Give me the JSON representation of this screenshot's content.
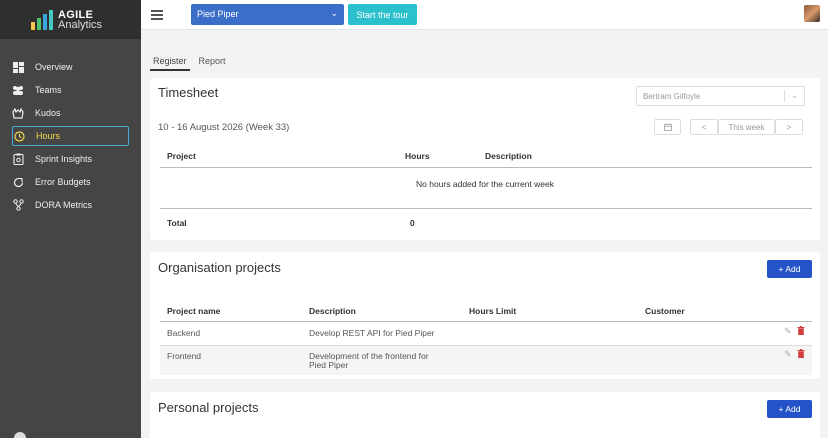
{
  "app": {
    "logo_line1": "AGILE",
    "logo_line2": "Analytics"
  },
  "sidebar": {
    "items": [
      {
        "label": "Overview",
        "icon": "dashboard-icon"
      },
      {
        "label": "Teams",
        "icon": "teams-icon"
      },
      {
        "label": "Kudos",
        "icon": "kudos-hands-icon"
      },
      {
        "label": "Hours",
        "icon": "clock-icon",
        "active": true
      },
      {
        "label": "Sprint Insights",
        "icon": "sprint-insights-icon"
      },
      {
        "label": "Error Budgets",
        "icon": "error-budget-icon"
      },
      {
        "label": "DORA Metrics",
        "icon": "dora-metrics-icon"
      }
    ]
  },
  "topbar": {
    "team_selected": "Pied Piper",
    "tour_button": "Start the tour"
  },
  "tabs": [
    "Register",
    "Report"
  ],
  "timesheet": {
    "title": "Timesheet",
    "user_selected": "Bertram Gilfoyle",
    "week_label": "10 - 16 August 2026 (Week 33)",
    "this_week_button": "This week",
    "prev_arrow": "<",
    "next_arrow": ">",
    "columns": [
      "Project",
      "Hours",
      "Description"
    ],
    "empty_message": "No hours added for the current week",
    "total_label": "Total",
    "total_value": "0"
  },
  "org_projects": {
    "title": "Organisation projects",
    "add_button": "+ Add",
    "columns": [
      "Project name",
      "Description",
      "Hours Limit",
      "Customer"
    ],
    "rows": [
      {
        "name": "Backend",
        "description": "Develop REST API for Pied Piper",
        "hours_limit": "",
        "customer": ""
      },
      {
        "name": "Frontend",
        "description_line1": "Development of the frontend for",
        "description_line2": "Pied Piper",
        "hours_limit": "",
        "customer": ""
      }
    ]
  },
  "personal_projects": {
    "title": "Personal projects",
    "add_button": "+ Add"
  },
  "colors": {
    "sidebar": "#454545",
    "accent_blue": "#2453c8",
    "tour": "#2bc0cc",
    "active_nav": "#f3d94c"
  }
}
